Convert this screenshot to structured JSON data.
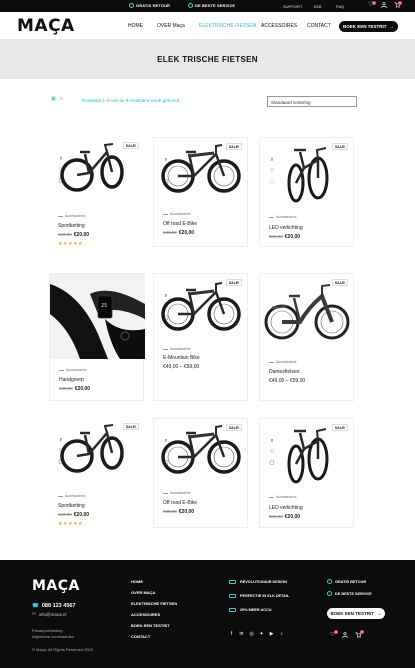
{
  "topbar": {
    "usp1": "GRATIS RETOUR",
    "usp2": "DE BESTE SERVICE",
    "links": [
      "SUPPORT",
      "B2B",
      "FAQ"
    ],
    "wishlist_count": "0",
    "cart_count": "0"
  },
  "header": {
    "logo": "MAÇA",
    "nav": [
      "HOME",
      "OVER Maça",
      "ELEKTRISCHE FIETSEN",
      "ACCESSOIRES",
      "CONTACT"
    ],
    "cta": "BOEK EEN TESTRIT",
    "cta_arrow": "→"
  },
  "hero": {
    "title": "ELEK TRISCHE FIETSEN"
  },
  "toolbar": {
    "result_count": "Resultaat 1–9 van de 9 resultaten wordt getoond",
    "sort_label": "Standaard sortering"
  },
  "products": [
    {
      "sale": "SALE!",
      "category": "Accessoires",
      "name": "Sportketting",
      "old_price": "€40,00",
      "price": "€20,00",
      "stars": "★★★★★"
    },
    {
      "sale": "SALE!",
      "category": "Accessoires",
      "name": "Off road E-Bike",
      "old_price": "€40,00",
      "price": "€20,00"
    },
    {
      "sale": "SALE!",
      "category": "Accessoires",
      "name": "LED verlichting",
      "old_price": "€40,00",
      "price": "€20,00"
    },
    {
      "sale": "",
      "category": "Accessoires",
      "name": "Handgreep",
      "old_price": "€40,00",
      "price": "€20,00"
    },
    {
      "sale": "SALE!",
      "category": "Accessoires",
      "name": "E-Mountain Bike",
      "old_price": "",
      "price": "€49,00 – €59,00"
    },
    {
      "sale": "SALE!",
      "category": "Accessoires",
      "name": "Damesfietsen",
      "old_price": "",
      "price": "€49,00 – €59,00"
    },
    {
      "sale": "SALE!",
      "category": "Accessoires",
      "name": "Sportketting",
      "old_price": "€40,00",
      "price": "€20,00",
      "stars": "★★★★★"
    },
    {
      "sale": "SALE!",
      "category": "Accessoires",
      "name": "Off road E-Bike",
      "old_price": "€40,00",
      "price": "€20,00"
    },
    {
      "sale": "SALE!",
      "category": "Accessoires",
      "name": "LED verlichting",
      "old_price": "€40,00",
      "price": "€20,00"
    }
  ],
  "footer": {
    "logo": "MAÇA",
    "phone": "088 123 4567",
    "email": "info@maca.nl",
    "privacy": "Privacyverklaring",
    "terms": "Algemene voorwaarden",
    "copyright": "© Maça, All Rights Reserved 2022",
    "nav": [
      "HOME",
      "OVER MAÇA",
      "ELEKTRISCHE FIETSEN",
      "ACCESSOIRES",
      "BOEK EEN TESTRIT",
      "CONTACT"
    ],
    "usps_mid": [
      "REVOLUTIONAIR DESIGN",
      "PERFECTIE IN ELK DETAIL",
      "20% MEER ACCU"
    ],
    "usps_right": [
      "GRATIS RETOUR",
      "DE BESTE SERVICE"
    ],
    "cta": "BOEK EEN TESTRIT",
    "wishlist_count": "0",
    "cart_count": "0"
  }
}
